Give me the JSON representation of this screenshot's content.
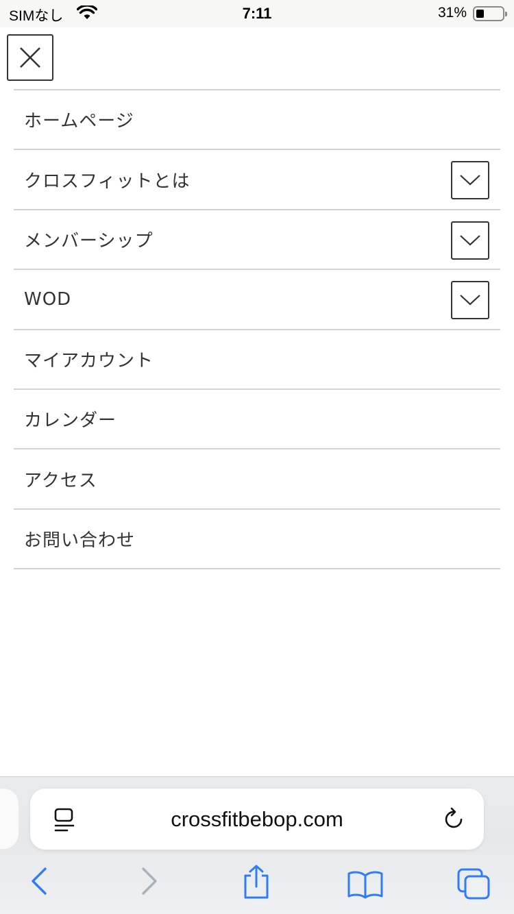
{
  "status_bar": {
    "carrier": "SIMなし",
    "time": "7:11",
    "battery_percent": "31%",
    "battery_level": 0.31,
    "icons": [
      "wifi-icon",
      "battery-icon"
    ]
  },
  "menu": {
    "close_icon": "close-icon",
    "items": [
      {
        "label": "ホームページ",
        "has_submenu": false
      },
      {
        "label": "クロスフィットとは",
        "has_submenu": true
      },
      {
        "label": "メンバーシップ",
        "has_submenu": true
      },
      {
        "label": "WOD",
        "has_submenu": true
      },
      {
        "label": "マイアカウント",
        "has_submenu": false
      },
      {
        "label": "カレンダー",
        "has_submenu": false
      },
      {
        "label": "アクセス",
        "has_submenu": false
      },
      {
        "label": "お問い合わせ",
        "has_submenu": false
      }
    ]
  },
  "browser": {
    "url": "crossfitbebop.com",
    "accent_color": "#2f7cf6",
    "toolbar_icons": [
      "back-icon",
      "forward-icon",
      "share-icon",
      "bookmarks-icon",
      "tabs-icon"
    ]
  }
}
